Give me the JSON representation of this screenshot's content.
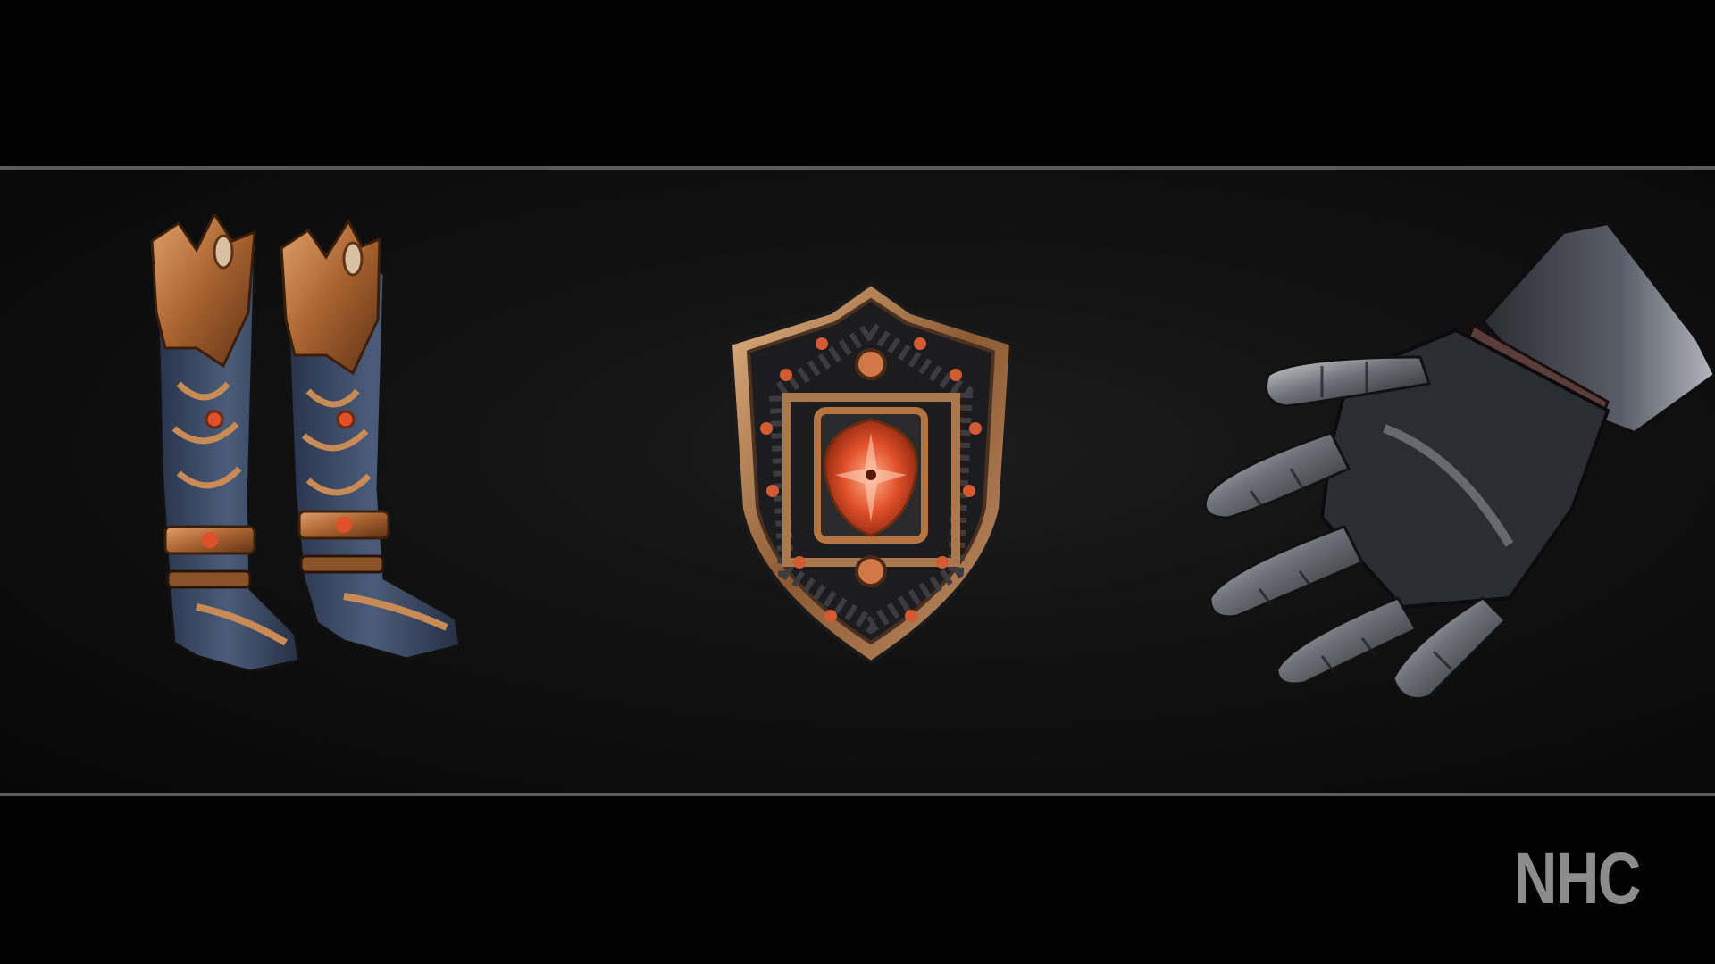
{
  "showcase": {
    "items": [
      {
        "name": "boots",
        "icon": "armored-boots-icon"
      },
      {
        "name": "shield",
        "icon": "ornate-shield-icon"
      },
      {
        "name": "gauntlet",
        "icon": "plate-gauntlet-icon"
      }
    ]
  },
  "watermark": {
    "text": "NHC"
  },
  "colors": {
    "background": "#020202",
    "rule": "#5a5a5a",
    "bronze": "#b8743e",
    "steel_blue": "#3f4f68",
    "ember": "#e0502a",
    "watermark": "#8c8c8c"
  }
}
